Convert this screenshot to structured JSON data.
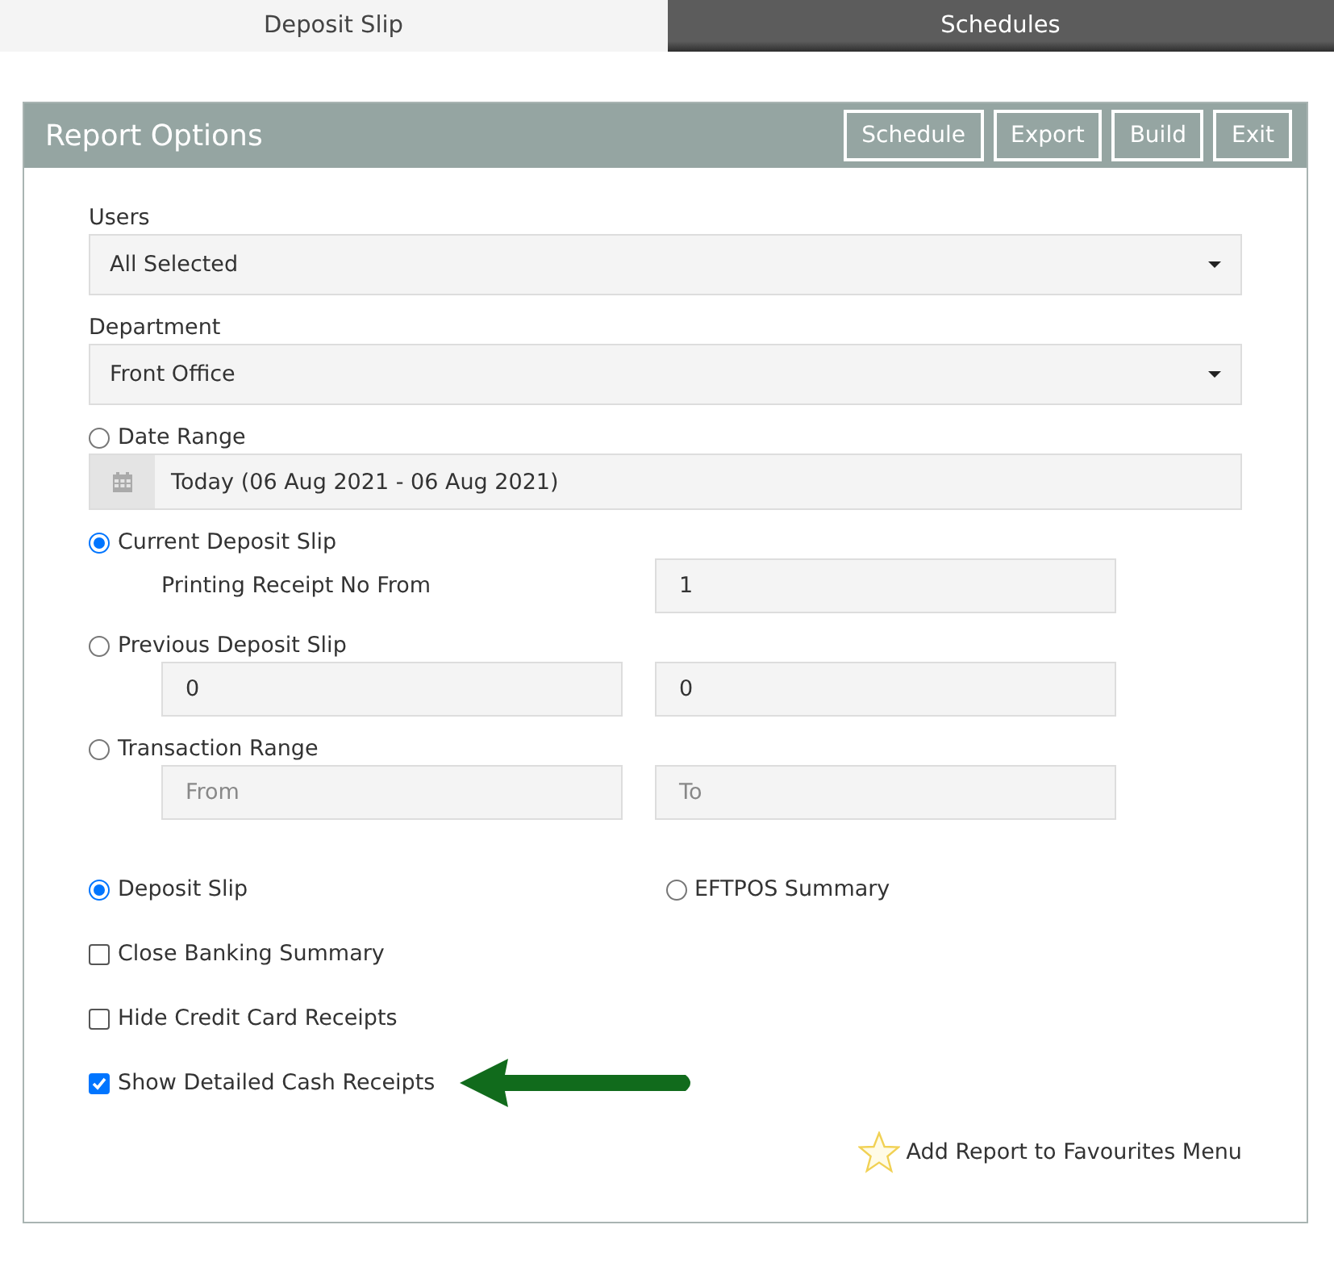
{
  "tabs": [
    {
      "label": "Deposit Slip",
      "selected": true
    },
    {
      "label": "Schedules",
      "selected": false
    }
  ],
  "panel": {
    "title": "Report Options",
    "buttons": [
      "Schedule",
      "Export",
      "Build",
      "Exit"
    ]
  },
  "selects": [
    {
      "label": "Users",
      "value": "All Selected"
    },
    {
      "label": "Department",
      "value": "Front Office"
    }
  ],
  "range_options": [
    {
      "kind": "date",
      "label": "Date Range",
      "selected": false,
      "value": "Today (06 Aug 2021 - 06 Aug 2021)"
    },
    {
      "kind": "receipt",
      "label": "Current Deposit Slip",
      "selected": true,
      "caption": "Printing Receipt No From",
      "value": "1"
    },
    {
      "kind": "pair",
      "label": "Previous Deposit Slip",
      "selected": false,
      "fields": [
        {
          "value": "0"
        },
        {
          "value": "0"
        }
      ]
    },
    {
      "kind": "pair",
      "label": "Transaction Range",
      "selected": false,
      "fields": [
        {
          "placeholder": "From"
        },
        {
          "placeholder": "To"
        }
      ]
    }
  ],
  "report_types": [
    {
      "label": "Deposit Slip",
      "selected": true
    },
    {
      "label": "EFTPOS Summary",
      "selected": false
    }
  ],
  "checkboxes": [
    {
      "label": "Close Banking Summary",
      "checked": false
    },
    {
      "label": "Hide Credit Card Receipts",
      "checked": false
    },
    {
      "label": "Show Detailed Cash Receipts",
      "checked": true
    }
  ],
  "favourites": {
    "label": "Add Report to Favourites Menu"
  }
}
